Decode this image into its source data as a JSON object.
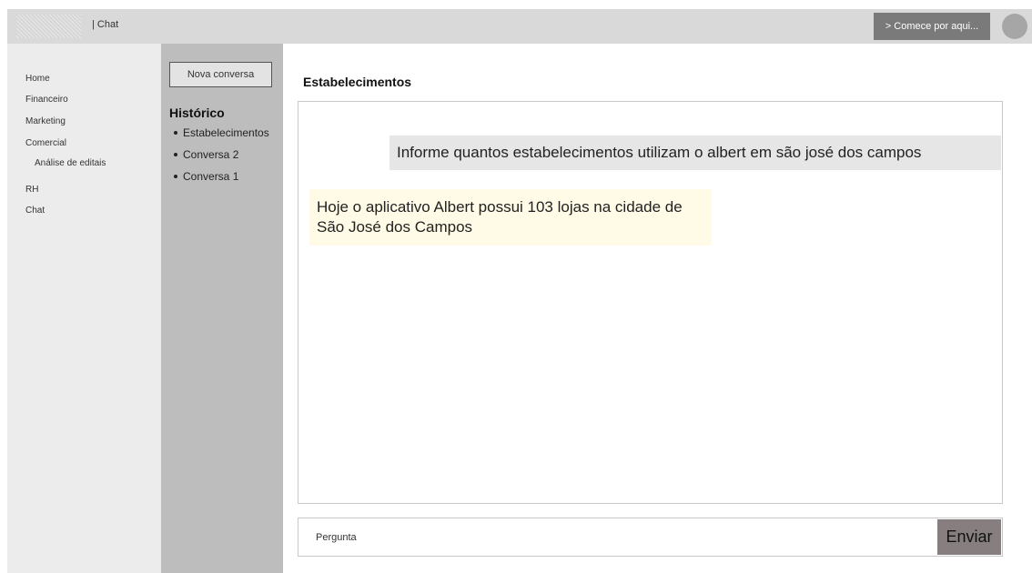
{
  "header": {
    "logo_icon": "logo-placeholder-icon",
    "app_title": "| Chat",
    "start_button": "> Comece por aqui...",
    "avatar_icon": "user-avatar-icon"
  },
  "nav": {
    "items": [
      {
        "label": "Home"
      },
      {
        "label": "Financeiro"
      },
      {
        "label": "Marketing"
      },
      {
        "label": "Comercial"
      },
      {
        "label": "Análise de editais"
      },
      {
        "label": "RH"
      },
      {
        "label": "Chat"
      }
    ]
  },
  "history": {
    "new_conversation": "Nova conversa",
    "title": "Histórico",
    "items": [
      {
        "label": "Estabelecimentos"
      },
      {
        "label": "Conversa 2"
      },
      {
        "label": "Conversa 1"
      }
    ]
  },
  "chat": {
    "title": "Estabelecimentos",
    "messages": [
      {
        "role": "user",
        "text": "Informe quantos estabelecimentos utilizam o albert em são josé dos campos"
      },
      {
        "role": "assistant",
        "text": "Hoje o aplicativo Albert possui 103 lojas na cidade de São José dos Campos"
      }
    ]
  },
  "composer": {
    "placeholder": "Pergunta",
    "send_label": "Enviar"
  },
  "colors": {
    "topbar": "#d9d9d9",
    "nav_bg": "#ececec",
    "history_bg": "#bdbdbd",
    "user_bubble": "#e6e6e6",
    "assistant_bubble": "#fffbe6",
    "send_button": "#877f7f"
  }
}
